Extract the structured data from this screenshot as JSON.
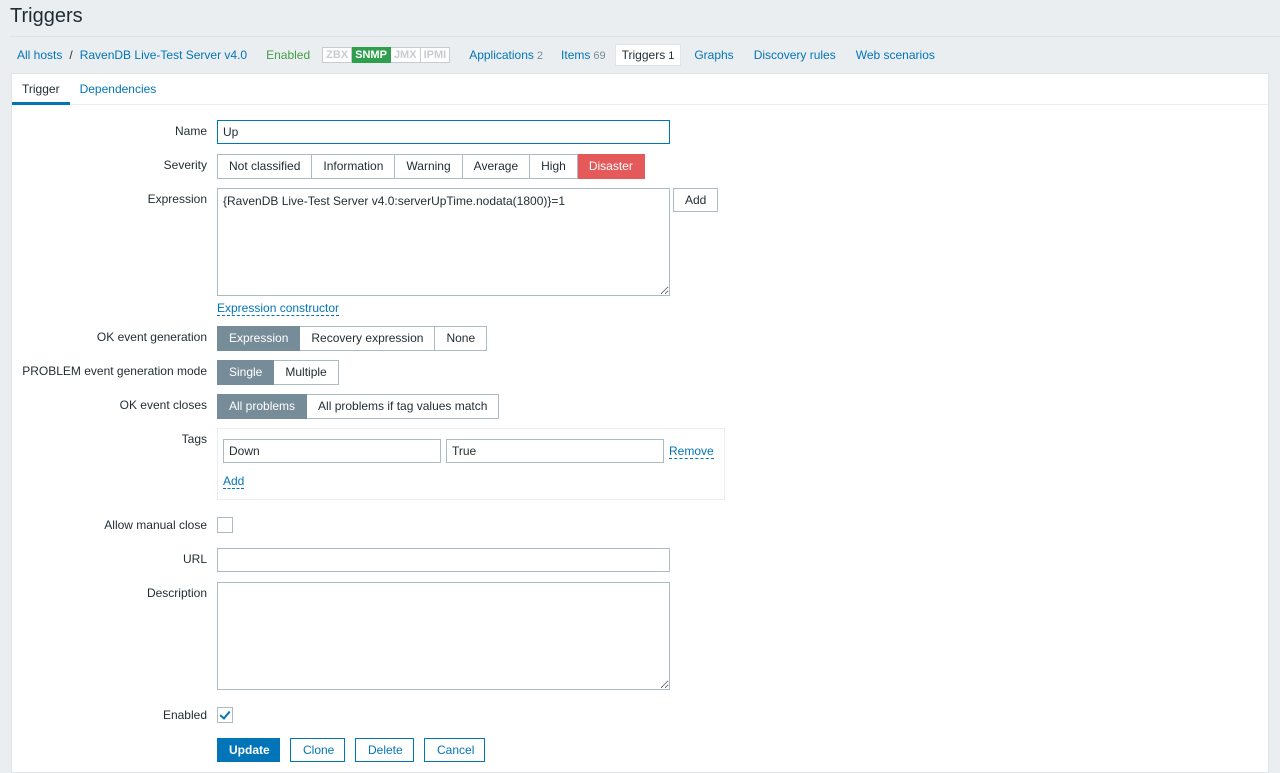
{
  "page": {
    "title": "Triggers"
  },
  "hostnav": {
    "all_hosts": "All hosts",
    "separator": "/",
    "host": "RavenDB Live-Test Server v4.0",
    "status": "Enabled",
    "availability": [
      {
        "label": "ZBX",
        "on": false
      },
      {
        "label": "SNMP",
        "on": true
      },
      {
        "label": "JMX",
        "on": false
      },
      {
        "label": "IPMI",
        "on": false
      }
    ],
    "links": [
      {
        "label": "Applications",
        "count": "2"
      },
      {
        "label": "Items",
        "count": "69"
      },
      {
        "label": "Triggers",
        "count": "1",
        "active": true
      },
      {
        "label": "Graphs",
        "count": ""
      },
      {
        "label": "Discovery rules",
        "count": ""
      },
      {
        "label": "Web scenarios",
        "count": ""
      }
    ]
  },
  "tabs": {
    "trigger": "Trigger",
    "dependencies": "Dependencies"
  },
  "form": {
    "name_label": "Name",
    "name_value": "Up",
    "severity_label": "Severity",
    "severity_options": [
      "Not classified",
      "Information",
      "Warning",
      "Average",
      "High",
      "Disaster"
    ],
    "severity_selected": "Disaster",
    "expression_label": "Expression",
    "expression_value": "{RavenDB Live-Test Server v4.0:serverUpTime.nodata(1800)}=1",
    "expression_add": "Add",
    "expression_constructor": "Expression constructor",
    "ok_event_generation_label": "OK event generation",
    "ok_event_generation_options": [
      "Expression",
      "Recovery expression",
      "None"
    ],
    "problem_mode_label": "PROBLEM event generation mode",
    "problem_mode_options": [
      "Single",
      "Multiple"
    ],
    "ok_event_closes_label": "OK event closes",
    "ok_event_closes_options": [
      "All problems",
      "All problems if tag values match"
    ],
    "tags_label": "Tags",
    "tag_name": "Down",
    "tag_value": "True",
    "tag_remove": "Remove",
    "tag_add": "Add",
    "allow_manual_close_label": "Allow manual close",
    "allow_manual_close": false,
    "url_label": "URL",
    "url_value": "",
    "description_label": "Description",
    "description_value": "",
    "enabled_label": "Enabled",
    "enabled": true
  },
  "buttons": {
    "update": "Update",
    "clone": "Clone",
    "delete": "Delete",
    "cancel": "Cancel"
  },
  "colors": {
    "link": "#0275b8",
    "disaster": "#e45959",
    "selected": "#768d99",
    "enabled": "#429e47",
    "snmp": "#2f9f4e"
  }
}
